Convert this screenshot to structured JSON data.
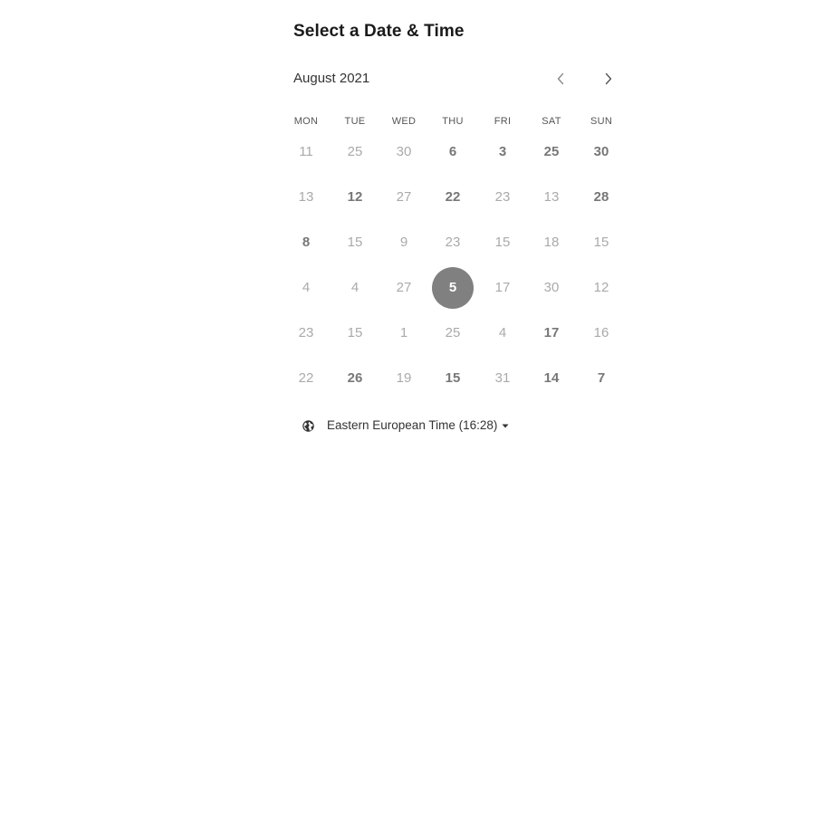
{
  "header": {
    "title": "Select a Date & Time"
  },
  "calendar": {
    "month_label": "August 2021",
    "prev_icon": "chevron-left-icon",
    "next_icon": "chevron-right-icon",
    "weekdays": [
      "MON",
      "TUE",
      "WED",
      "THU",
      "FRI",
      "SAT",
      "SUN"
    ],
    "weeks": [
      [
        {
          "label": "11",
          "available": false,
          "selected": false
        },
        {
          "label": "25",
          "available": false,
          "selected": false
        },
        {
          "label": "30",
          "available": false,
          "selected": false
        },
        {
          "label": "6",
          "available": true,
          "selected": false
        },
        {
          "label": "3",
          "available": true,
          "selected": false
        },
        {
          "label": "25",
          "available": true,
          "selected": false
        },
        {
          "label": "30",
          "available": true,
          "selected": false
        }
      ],
      [
        {
          "label": "13",
          "available": false,
          "selected": false
        },
        {
          "label": "12",
          "available": true,
          "selected": false
        },
        {
          "label": "27",
          "available": false,
          "selected": false
        },
        {
          "label": "22",
          "available": true,
          "selected": false
        },
        {
          "label": "23",
          "available": false,
          "selected": false
        },
        {
          "label": "13",
          "available": false,
          "selected": false
        },
        {
          "label": "28",
          "available": true,
          "selected": false
        }
      ],
      [
        {
          "label": "8",
          "available": true,
          "selected": false
        },
        {
          "label": "15",
          "available": false,
          "selected": false
        },
        {
          "label": "9",
          "available": false,
          "selected": false
        },
        {
          "label": "23",
          "available": false,
          "selected": false
        },
        {
          "label": "15",
          "available": false,
          "selected": false
        },
        {
          "label": "18",
          "available": false,
          "selected": false
        },
        {
          "label": "15",
          "available": false,
          "selected": false
        }
      ],
      [
        {
          "label": "4",
          "available": false,
          "selected": false
        },
        {
          "label": "4",
          "available": false,
          "selected": false
        },
        {
          "label": "27",
          "available": false,
          "selected": false
        },
        {
          "label": "5",
          "available": true,
          "selected": true
        },
        {
          "label": "17",
          "available": false,
          "selected": false
        },
        {
          "label": "30",
          "available": false,
          "selected": false
        },
        {
          "label": "12",
          "available": false,
          "selected": false
        }
      ],
      [
        {
          "label": "23",
          "available": false,
          "selected": false
        },
        {
          "label": "15",
          "available": false,
          "selected": false
        },
        {
          "label": "1",
          "available": false,
          "selected": false
        },
        {
          "label": "25",
          "available": false,
          "selected": false
        },
        {
          "label": "4",
          "available": false,
          "selected": false
        },
        {
          "label": "17",
          "available": true,
          "selected": false
        },
        {
          "label": "16",
          "available": false,
          "selected": false
        }
      ],
      [
        {
          "label": "22",
          "available": false,
          "selected": false
        },
        {
          "label": "26",
          "available": true,
          "selected": false
        },
        {
          "label": "19",
          "available": false,
          "selected": false
        },
        {
          "label": "15",
          "available": true,
          "selected": false
        },
        {
          "label": "31",
          "available": false,
          "selected": false
        },
        {
          "label": "14",
          "available": true,
          "selected": false
        },
        {
          "label": "7",
          "available": true,
          "selected": false
        }
      ]
    ]
  },
  "timezone": {
    "label": "Eastern European Time (16:28)",
    "icon": "globe-icon",
    "caret_icon": "caret-down-icon"
  },
  "colors": {
    "selected_bg": "#808080",
    "available_text": "#777777",
    "unavailable_text": "#aaaaaa",
    "title_text": "#1a1a1a"
  }
}
